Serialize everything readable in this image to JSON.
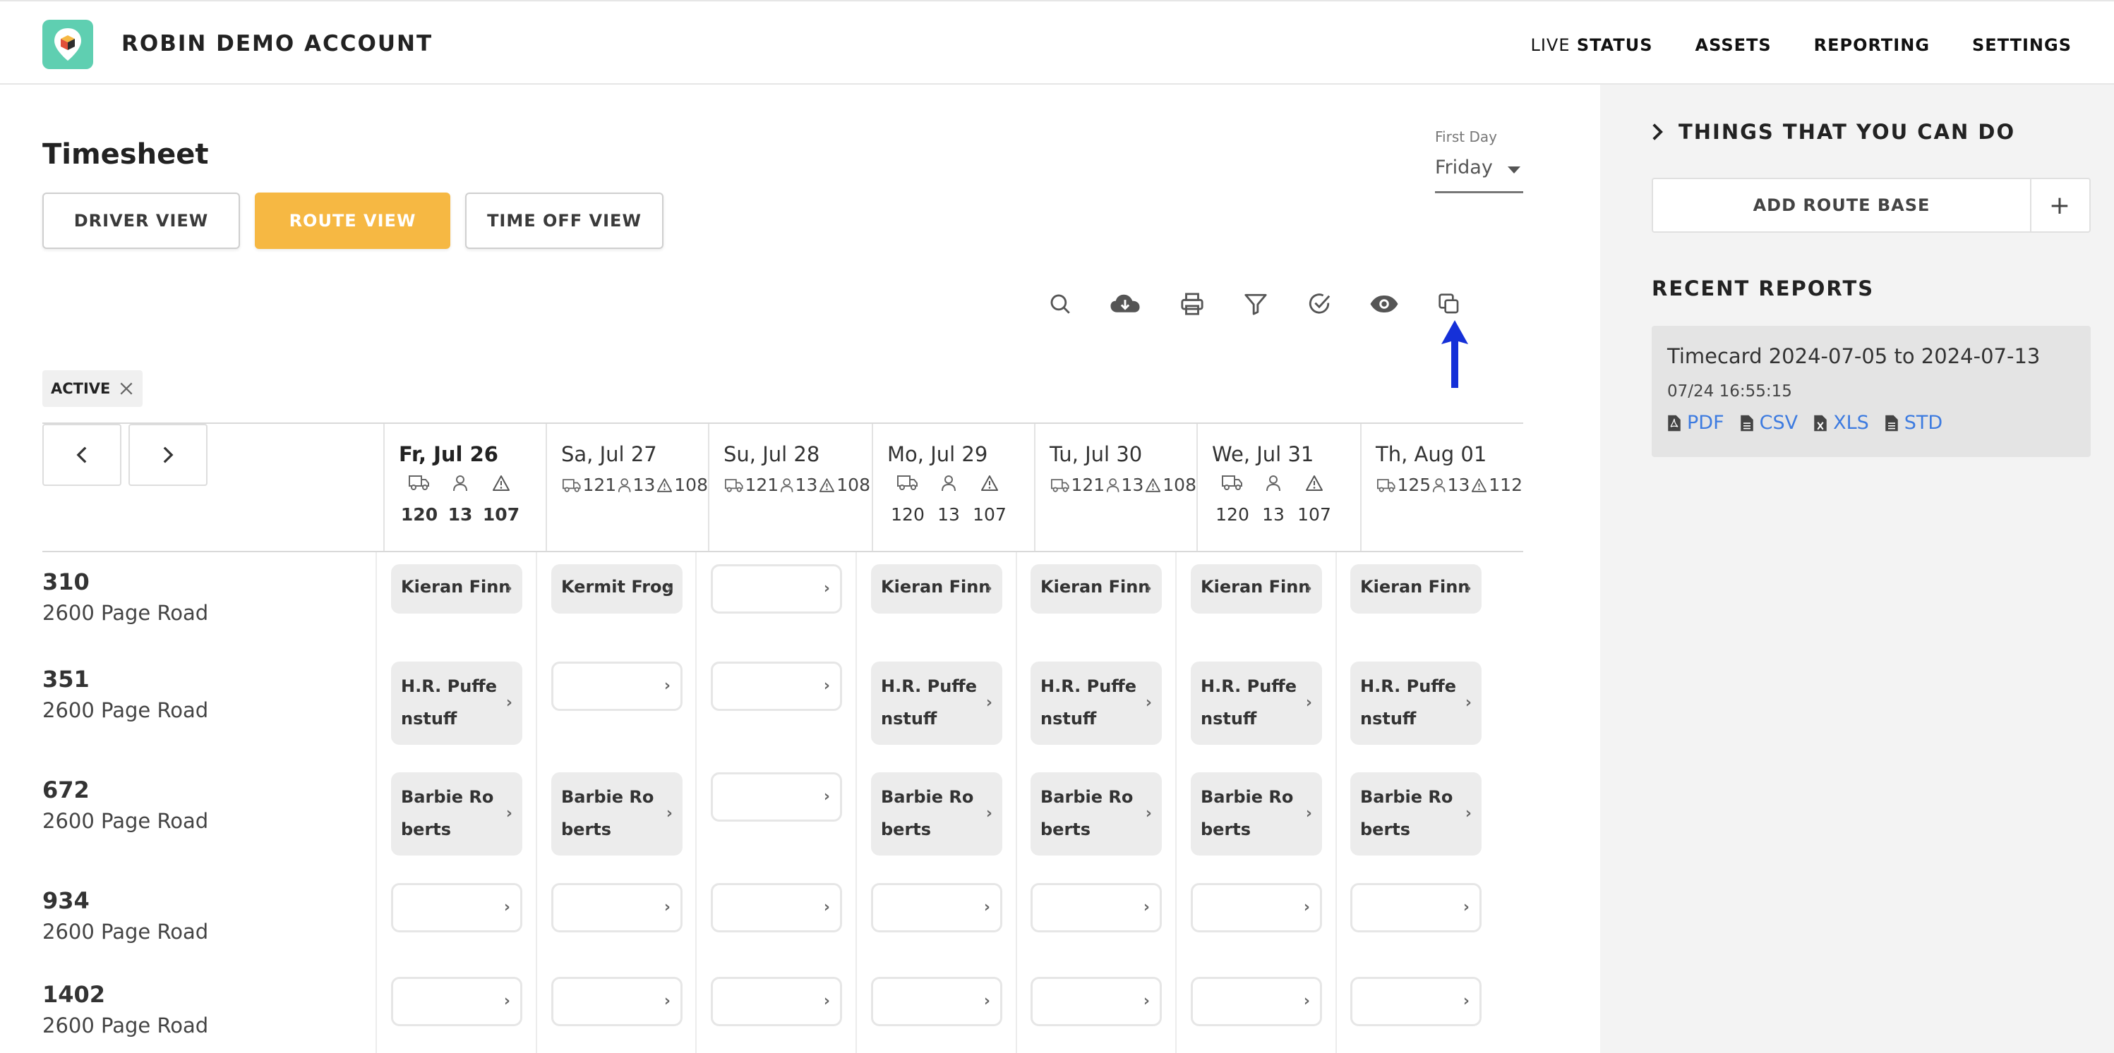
{
  "header": {
    "brand": "ROBIN DEMO ACCOUNT",
    "nav": [
      {
        "prefix": "LIVE",
        "label": "STATUS"
      },
      {
        "prefix": "",
        "label": "ASSETS"
      },
      {
        "prefix": "",
        "label": "REPORTING"
      },
      {
        "prefix": "",
        "label": "SETTINGS"
      }
    ]
  },
  "page": {
    "title": "Timesheet",
    "views": [
      "DRIVER VIEW",
      "ROUTE VIEW",
      "TIME OFF VIEW"
    ],
    "active_view": "ROUTE VIEW",
    "first_day_label": "First Day",
    "first_day_value": "Friday",
    "toolbar_icons": [
      "search-icon",
      "cloud-download-icon",
      "print-icon",
      "filter-icon",
      "check-circle-icon",
      "eye-icon",
      "copy-icon"
    ],
    "filter_chip": "ACTIVE"
  },
  "days": [
    {
      "label": "Fr, Jul 26",
      "trucks": "120",
      "people": "13",
      "alerts": "107"
    },
    {
      "label": "Sa, Jul 27",
      "trucks": "121",
      "people": "13",
      "alerts": "108"
    },
    {
      "label": "Su, Jul 28",
      "trucks": "121",
      "people": "13",
      "alerts": "108"
    },
    {
      "label": "Mo, Jul 29",
      "trucks": "120",
      "people": "13",
      "alerts": "107"
    },
    {
      "label": "Tu, Jul 30",
      "trucks": "121",
      "people": "13",
      "alerts": "108"
    },
    {
      "label": "We, Jul 31",
      "trucks": "120",
      "people": "13",
      "alerts": "107"
    },
    {
      "label": "Th, Aug 01",
      "trucks": "125",
      "people": "13",
      "alerts": "112"
    }
  ],
  "routes": [
    {
      "number": "310",
      "address": "2600 Page Road",
      "cells": [
        "Kieran Finn",
        "Kermit Frog",
        "",
        "Kieran Finn",
        "Kieran Finn",
        "Kieran Finn",
        "Kieran Finn"
      ]
    },
    {
      "number": "351",
      "address": "2600 Page Road",
      "cells": [
        "H.R. Puffenstuff",
        "",
        "",
        "H.R. Puffenstuff",
        "H.R. Puffenstuff",
        "H.R. Puffenstuff",
        "H.R. Puffenstuff"
      ]
    },
    {
      "number": "672",
      "address": "2600 Page Road",
      "cells": [
        "Barbie Roberts",
        "Barbie Roberts",
        "",
        "Barbie Roberts",
        "Barbie Roberts",
        "Barbie Roberts",
        "Barbie Roberts"
      ]
    },
    {
      "number": "934",
      "address": "2600 Page Road",
      "cells": [
        "",
        "",
        "",
        "",
        "",
        "",
        ""
      ]
    },
    {
      "number": "1402",
      "address": "2600 Page Road",
      "cells": [
        "",
        "",
        "",
        "",
        "",
        "",
        ""
      ]
    }
  ],
  "side": {
    "things_title": "THINGS THAT YOU CAN DO",
    "add_route_base": "ADD ROUTE BASE",
    "add_symbol": "+",
    "recent_title": "RECENT REPORTS",
    "report": {
      "name": "Timecard 2024-07-05 to 2024-07-13",
      "time": "07/24 16:55:15",
      "formats": [
        "PDF",
        "CSV",
        "XLS",
        "STD"
      ]
    }
  },
  "colors": {
    "accent": "#f6b843",
    "link": "#3d7be0",
    "arrow": "#1530d8",
    "logo": "#5fcfb1"
  }
}
